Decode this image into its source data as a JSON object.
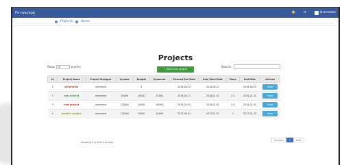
{
  "navbar": {
    "brand": "Pm-wayapp",
    "items": [
      "",
      "",
      "Username"
    ]
  },
  "breadcrumb": [
    "Projects",
    "Home"
  ],
  "page_title": "Projects",
  "add_button_label": "+ Add a new project",
  "controls": {
    "show_label": "Show",
    "show_value": "10",
    "entries_label": "entries",
    "search_label": "Search:"
  },
  "table": {
    "headers": [
      "Id",
      "Project Name",
      "Project Manager",
      "Income",
      "Budget",
      "Expenses",
      "Planned End Date",
      "Real Start Date",
      "Done",
      "End Date",
      "Actions"
    ],
    "rows": [
      [
        "1",
        "old project",
        "username",
        "",
        "0",
        "",
        "2018-08-22",
        "2018-08-22",
        "",
        "2018-08-22",
        "Show"
      ],
      [
        "2",
        "new project",
        "username",
        "90000",
        "40000",
        "25000",
        "2018-08-21",
        "2018-02-01",
        "0.5",
        "2018-01-20",
        "Show"
      ],
      [
        "3",
        "new project",
        "username",
        "120000",
        "10000",
        "40000",
        "2018-05-01",
        "2018-01-01",
        "0.5",
        "2018-01-05",
        "Show"
      ],
      [
        "4",
        "another project",
        "username",
        "120000",
        "10000",
        "20000",
        "2017-06-01",
        "2017-01-01",
        "1",
        "2017-01-20",
        "Show"
      ]
    ]
  },
  "footer": "Showing 1 to 4 of 4 entries",
  "pager": [
    "Previous",
    "1",
    "Next"
  ]
}
